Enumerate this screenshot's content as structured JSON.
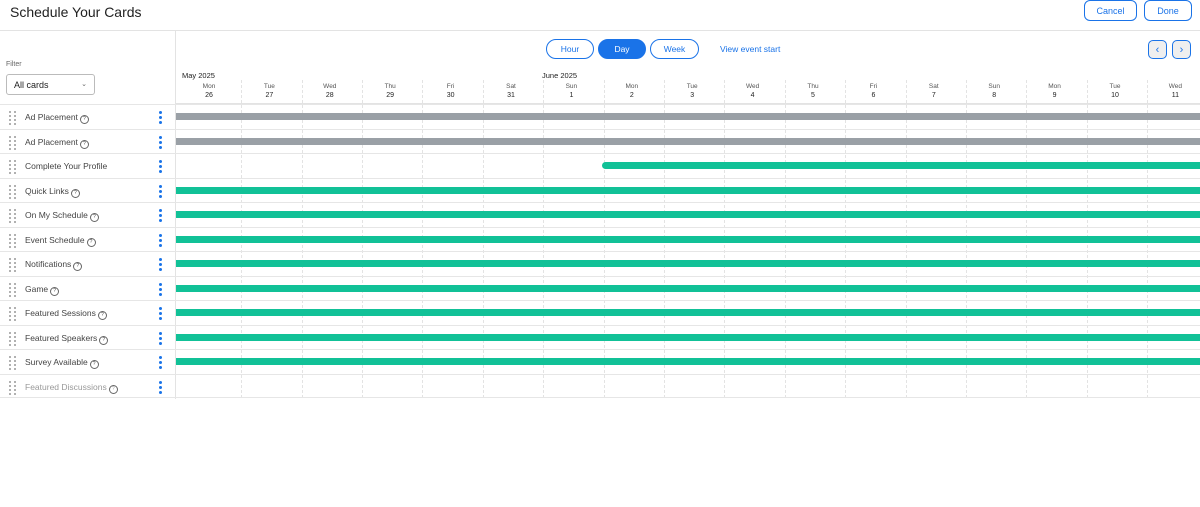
{
  "title": "Schedule Your Cards",
  "actions": {
    "cancel": "Cancel",
    "done": "Done"
  },
  "filter": {
    "label": "Filter",
    "value": "All cards"
  },
  "view_tabs": [
    {
      "label": "Hour",
      "active": false
    },
    {
      "label": "Day",
      "active": true
    },
    {
      "label": "Week",
      "active": false
    }
  ],
  "view_event_start": "View event start",
  "months": [
    "May 2025",
    "June 2025"
  ],
  "days": [
    {
      "dow": "Mon",
      "num": "26"
    },
    {
      "dow": "Tue",
      "num": "27"
    },
    {
      "dow": "Wed",
      "num": "28"
    },
    {
      "dow": "Thu",
      "num": "29"
    },
    {
      "dow": "Fri",
      "num": "30"
    },
    {
      "dow": "Sat",
      "num": "31"
    },
    {
      "dow": "Sun",
      "num": "1"
    },
    {
      "dow": "Mon",
      "num": "2"
    },
    {
      "dow": "Tue",
      "num": "3"
    },
    {
      "dow": "Wed",
      "num": "4"
    },
    {
      "dow": "Thu",
      "num": "5"
    },
    {
      "dow": "Fri",
      "num": "6"
    },
    {
      "dow": "Sat",
      "num": "7"
    },
    {
      "dow": "Sun",
      "num": "8"
    },
    {
      "dow": "Mon",
      "num": "9"
    },
    {
      "dow": "Tue",
      "num": "10"
    },
    {
      "dow": "Wed",
      "num": "11"
    }
  ],
  "cards": [
    {
      "name": "Ad Placement",
      "help": true,
      "status": "inactive",
      "start_day": "26"
    },
    {
      "name": "Ad Placement",
      "help": true,
      "status": "inactive",
      "start_day": "26"
    },
    {
      "name": "Complete Your Profile",
      "help": false,
      "status": "active",
      "start_day": "2"
    },
    {
      "name": "Quick Links",
      "help": true,
      "status": "active",
      "start_day": "26"
    },
    {
      "name": "On My Schedule",
      "help": true,
      "status": "active",
      "start_day": "26"
    },
    {
      "name": "Event Schedule",
      "help": true,
      "status": "active",
      "start_day": "26"
    },
    {
      "name": "Notifications",
      "help": true,
      "status": "active",
      "start_day": "26"
    },
    {
      "name": "Game",
      "help": true,
      "status": "active",
      "start_day": "26"
    },
    {
      "name": "Featured Sessions",
      "help": true,
      "status": "active",
      "start_day": "26"
    },
    {
      "name": "Featured Speakers",
      "help": true,
      "status": "active",
      "start_day": "26"
    },
    {
      "name": "Survey Available",
      "help": true,
      "status": "active",
      "start_day": "26"
    },
    {
      "name": "Featured Discussions",
      "help": true,
      "status": "disabled",
      "start_day": ""
    }
  ],
  "colors": {
    "accent": "#1a73e8",
    "active_bar": "#11c197",
    "inactive_bar": "#9aa0a6"
  }
}
